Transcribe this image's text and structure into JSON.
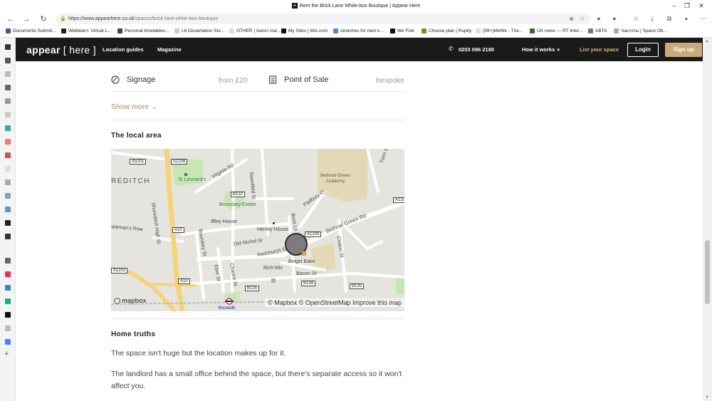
{
  "window": {
    "title": "Rent the Brick Lane White-box Boutique | Appear Here"
  },
  "browser": {
    "url_domain": "https://www.appearhere.co.uk",
    "url_path": "/spaces/brick-lane-white-box-boutique"
  },
  "bookmarks": [
    {
      "label": "Documents Submit...",
      "color": "#3b5998"
    },
    {
      "label": "Weblearn: Virtual L...",
      "color": "#222222"
    },
    {
      "label": "Personal timetables...",
      "color": "#444444"
    },
    {
      "label": "L6 Dissertation Stu...",
      "color": "#cccccc"
    },
    {
      "label": "OTHER | Aaron Gal...",
      "color": "#dddddd"
    },
    {
      "label": "My Sites | Wix.com",
      "color": "#111111"
    },
    {
      "label": "stretches for men k...",
      "color": "#4285f4"
    },
    {
      "label": "We Folk",
      "color": "#111111"
    },
    {
      "label": "Choose plan | Ruptly",
      "color": "#6a9a1f"
    },
    {
      "label": "(99+)MeWe - The...",
      "color": "#e0e0e0"
    },
    {
      "label": "UK news — RT Inter...",
      "color": "#2f6f2f"
    },
    {
      "label": "ABTA",
      "color": "#777777"
    },
    {
      "label": "Частоты | Space Ob...",
      "color": "#aaaaaa"
    }
  ],
  "header": {
    "logo": "appear",
    "logo_bracket": "[ here ]",
    "nav_location_guides": "Location guides",
    "nav_magazine": "Magazine",
    "phone": "0203 096 2180",
    "how_it_works": "How it works",
    "list_your_space": "List your space",
    "login": "Login",
    "signup": "Sign up"
  },
  "amenities": [
    {
      "name": "Signage",
      "price": "from £20",
      "icon": "signage-icon"
    },
    {
      "name": "Point of Sale",
      "price": "bespoke",
      "icon": "point-of-sale-icon"
    }
  ],
  "show_more": "Show more",
  "local_area": {
    "heading": "The local area",
    "map_labels": {
      "shoreditch": "REDITCH",
      "shoreditch_high_st": "Shoreditch High St",
      "virginia_rd": "Virginia Rd",
      "st_leonards": "St Leonard's",
      "swanfield_st": "Swanfield St",
      "bethnal_green_academy": "Bethnal Green Academy",
      "turin_st": "Turin St",
      "boundary_estate": "Boundary Estate",
      "padbury_ct": "Padbury Ct",
      "bethnal_green_rd": "Bethnal Green Rd",
      "batemans_row": "Bateman's Row",
      "iffley_house": "Iffley House",
      "henley_house": "Henley House",
      "brick_ln": "Brick Ln",
      "boundary_st": "Boundary St",
      "old_nichol_st": "Old Nichol St",
      "redchurch_st": "Redchurch St",
      "chilton_st": "Chilton St",
      "ebor_st": "Ebor St",
      "chance_st": "Chance St",
      "rich_mix": "Rich Mix",
      "beigel_bake": "Beigel Bake",
      "bacon_st": "Bacon St",
      "shoreditch_station": "Shoredit",
      "a5201": "A5201",
      "a1208": "A1208",
      "b122": "B122",
      "a10": "A10",
      "a10b": "A10",
      "a1209": "A1209",
      "a1202": "A1202",
      "b125": "B125",
      "b134": "B134",
      "b135": "B135",
      "a120": "A120"
    },
    "mapbox_logo": "mapbox",
    "attribution": "© Mapbox © OpenStreetMap Improve this map"
  },
  "home_truths": {
    "heading": "Home truths",
    "paragraphs": [
      "The space isn't huge but the location makes up for it.",
      "The landlord has a small office behind the space, but there's separate access so it won't affect you."
    ]
  },
  "colors": {
    "header_bg": "#1a1a1a",
    "accent": "#c9aa7c",
    "link": "#a68a64",
    "map_road_major": "#f5d37a",
    "map_park": "#c8e6b5",
    "map_building": "#e3d9b7"
  }
}
